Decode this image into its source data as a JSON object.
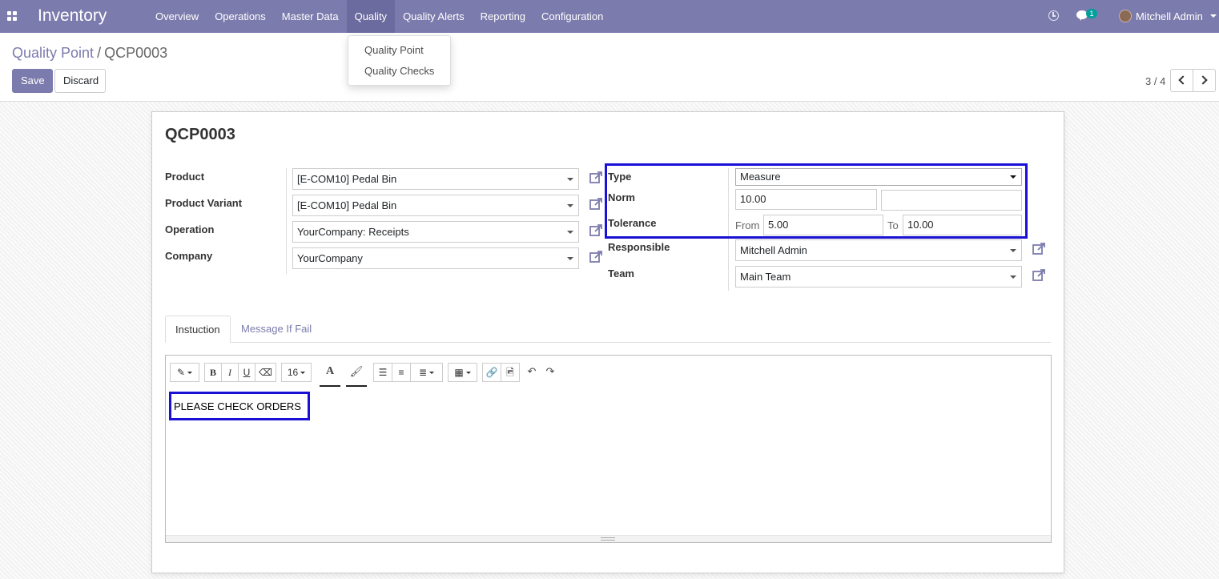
{
  "app": {
    "name": "Inventory"
  },
  "navbar": {
    "menu": [
      "Overview",
      "Operations",
      "Master Data",
      "Quality",
      "Quality Alerts",
      "Reporting",
      "Configuration"
    ],
    "active_menu": "Quality",
    "chat_count": "1",
    "user_name": "Mitchell Admin",
    "bg_color": "#7c7bad"
  },
  "dropdown": {
    "items": [
      "Quality Point",
      "Quality Checks"
    ]
  },
  "breadcrumb": {
    "parent": "Quality Point",
    "separator": "/",
    "current": "QCP0003"
  },
  "buttons": {
    "save": "Save",
    "discard": "Discard"
  },
  "pager": {
    "value": "3 / 4"
  },
  "record": {
    "title": "QCP0003",
    "left_fields": {
      "product": {
        "label": "Product",
        "value": "[E-COM10] Pedal Bin"
      },
      "product_variant": {
        "label": "Product Variant",
        "value": "[E-COM10] Pedal Bin"
      },
      "operation": {
        "label": "Operation",
        "value": "YourCompany: Receipts"
      },
      "company": {
        "label": "Company",
        "value": "YourCompany"
      }
    },
    "right_fields": {
      "type": {
        "label": "Type",
        "value": "Measure"
      },
      "norm": {
        "label": "Norm",
        "value": "10.00",
        "unit": ""
      },
      "tolerance": {
        "label": "Tolerance",
        "from_label": "From",
        "from_value": "5.00",
        "to_label": "To",
        "to_value": "10.00"
      },
      "responsible": {
        "label": "Responsible",
        "value": "Mitchell Admin"
      },
      "team": {
        "label": "Team",
        "value": "Main Team"
      }
    }
  },
  "tabs": [
    "Instuction",
    "Message If Fail"
  ],
  "editor": {
    "font_size": "16",
    "content": "PLEASE CHECK ORDERS"
  },
  "colors": {
    "accent": "#7c7bad",
    "highlight": "#1a10d6",
    "badge": "#00a09d"
  }
}
